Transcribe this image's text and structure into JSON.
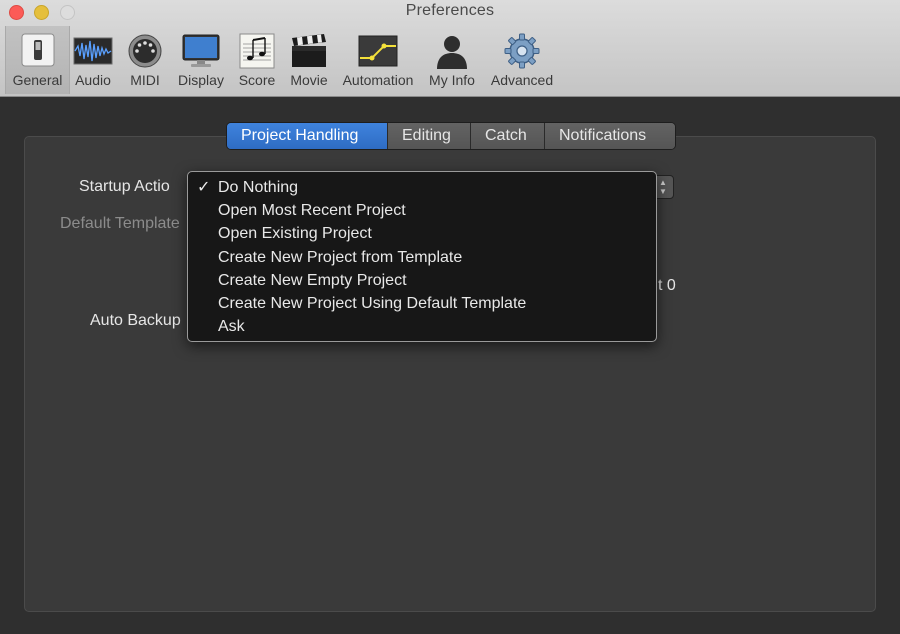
{
  "window": {
    "title": "Preferences"
  },
  "toolbar": {
    "items": [
      {
        "label": "General",
        "icon": "general-switch-icon",
        "selected": true
      },
      {
        "label": "Audio",
        "icon": "audio-waveform-icon"
      },
      {
        "label": "MIDI",
        "icon": "midi-connector-icon"
      },
      {
        "label": "Display",
        "icon": "display-monitor-icon"
      },
      {
        "label": "Score",
        "icon": "score-notes-icon"
      },
      {
        "label": "Movie",
        "icon": "movie-clapper-icon"
      },
      {
        "label": "Automation",
        "icon": "automation-curve-icon"
      },
      {
        "label": "My Info",
        "icon": "person-silhouette-icon"
      },
      {
        "label": "Advanced",
        "icon": "gear-icon"
      }
    ]
  },
  "tabs": [
    {
      "label": "Project Handling",
      "active": true
    },
    {
      "label": "Editing"
    },
    {
      "label": "Catch"
    },
    {
      "label": "Notifications"
    }
  ],
  "form": {
    "startup_action_label": "Startup Actio",
    "default_template_label": "Default Template",
    "auto_backup_label": "Auto Backup",
    "partial_right_text": "t 0"
  },
  "startup_menu": {
    "selected": "Do Nothing",
    "checkmark": "✓",
    "options": [
      "Do Nothing",
      "Open Most Recent Project",
      "Open Existing Project",
      "Create New Project from Template",
      "Create New Empty Project",
      "Create New Project Using Default Template",
      "Ask"
    ]
  },
  "colors": {
    "accent": "#3474d0",
    "background": "#2f2f2f"
  }
}
